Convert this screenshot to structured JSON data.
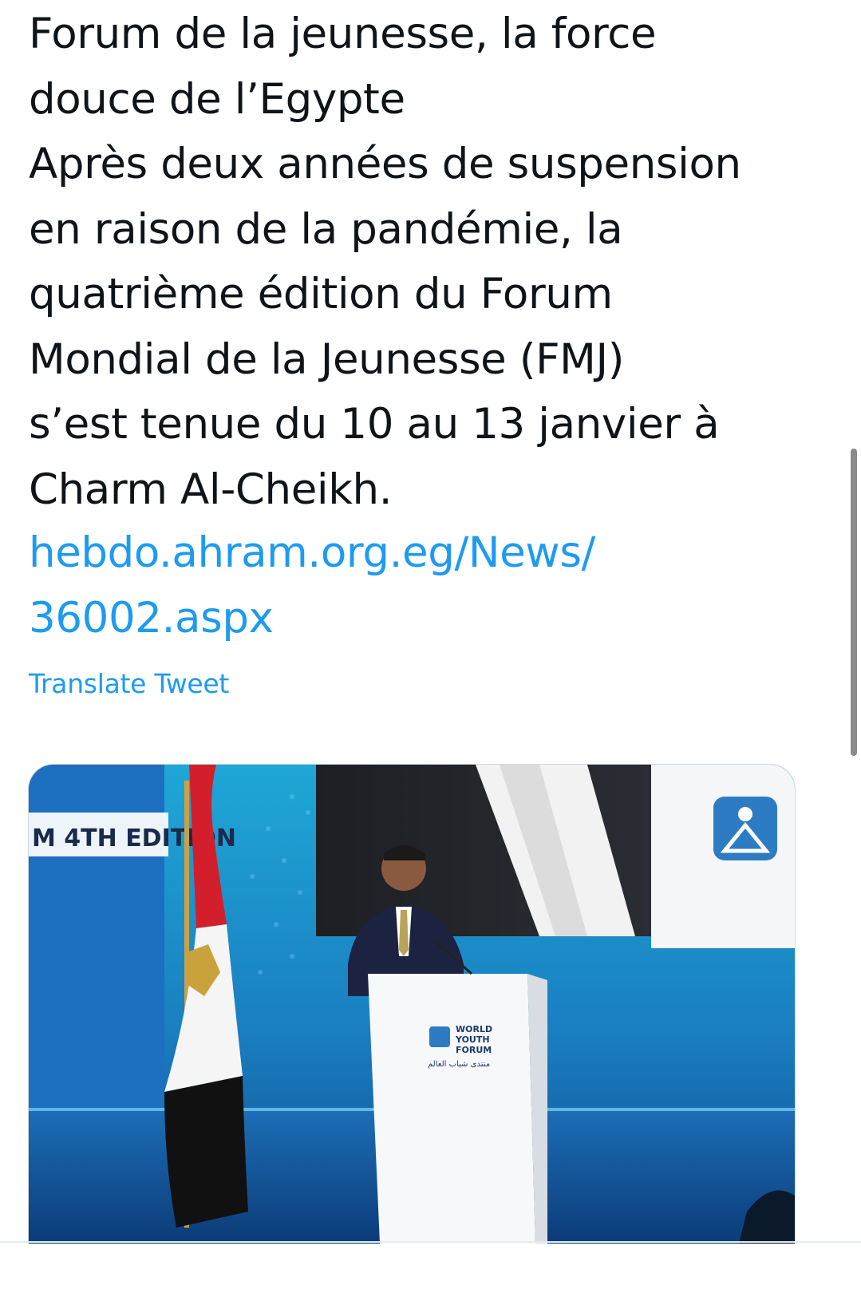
{
  "tweet": {
    "text_lines": [
      "Forum de la jeunesse, la force",
      "douce de l’Egypte",
      "Après deux années de suspension",
      "en raison de la pandémie, la",
      "quatrième édition du Forum",
      "Mondial de la Jeunesse (FMJ)",
      "s’est tenue du 10 au 13 janvier à",
      "Charm Al-Cheikh."
    ],
    "link_lines": [
      "hebdo.ahram.org.eg/News/",
      "36002.aspx"
    ],
    "translate_label": "Translate Tweet"
  },
  "media": {
    "image_texts": {
      "banner_left": "M 4TH EDITION",
      "podium_logo_lines": [
        "WORLD",
        "YOUTH",
        "FORUM"
      ],
      "arabic_caption": "منتدى شباب العالم"
    }
  },
  "colors": {
    "text": "#0f1419",
    "link": "#1d9bf0",
    "scrollbar": "#8a8a8a"
  }
}
